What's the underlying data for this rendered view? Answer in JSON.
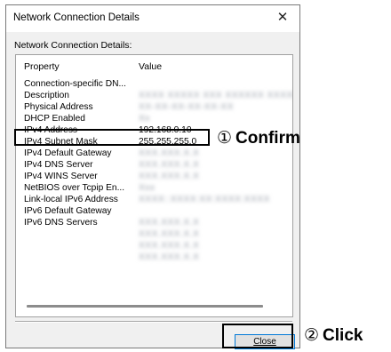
{
  "window": {
    "title": "Network Connection Details",
    "close_glyph": "✕"
  },
  "group_label": "Network Connection Details:",
  "columns": {
    "property": "Property",
    "value": "Value"
  },
  "rows": [
    {
      "property": "Connection-specific DN...",
      "value": ""
    },
    {
      "property": "Description",
      "value": "XXXX XXXXX XXX XXXXXX XXXXX"
    },
    {
      "property": "Physical Address",
      "value": "XX-XX-XX-XX-XX-XX"
    },
    {
      "property": "DHCP Enabled",
      "value": "Xx"
    },
    {
      "property": "IPv4 Address",
      "value": "192.168.0.10"
    },
    {
      "property": "IPv4 Subnet Mask",
      "value": "255.255.255.0"
    },
    {
      "property": "IPv4 Default Gateway",
      "value": "XXX.XXX.X.X"
    },
    {
      "property": "IPv4 DNS Server",
      "value": "XXX.XXX.X.X"
    },
    {
      "property": "IPv4 WINS Server",
      "value": "XXX.XXX.X.X"
    },
    {
      "property": "NetBIOS over Tcpip En...",
      "value": "Xxx"
    },
    {
      "property": "Link-local IPv6 Address",
      "value": "XXXX::XXXX:XX:XXXX:XXXX"
    },
    {
      "property": "IPv6 Default Gateway",
      "value": ""
    },
    {
      "property": "IPv6 DNS Servers",
      "value": "XXX.XXX.X.X"
    },
    {
      "property": "",
      "value": "XXX.XXX.X.X"
    },
    {
      "property": "",
      "value": "XXX.XXX.X.X"
    },
    {
      "property": "",
      "value": "XXX.XXX.X.X"
    }
  ],
  "close_button_label": "Close",
  "callouts": {
    "confirm_number": "①",
    "confirm_text": "Confirm",
    "click_number": "②",
    "click_text": "Click"
  }
}
